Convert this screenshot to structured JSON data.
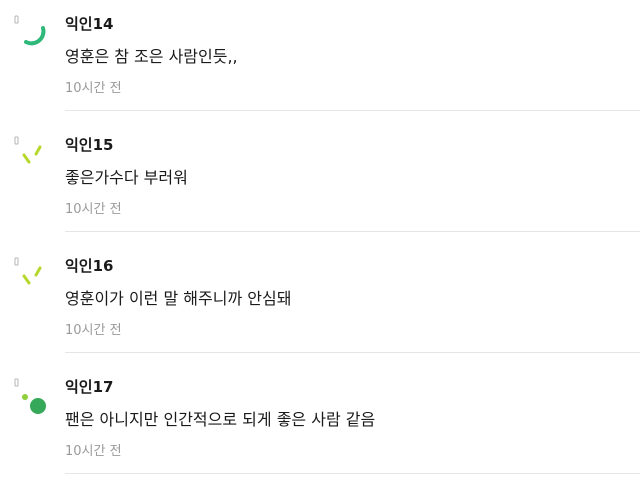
{
  "colors": {
    "green": "#2eb87a",
    "lime": "#b6d82c",
    "dark_green": "#36a85a",
    "badge_gray": "#b5b5b5"
  },
  "comments": [
    {
      "author": "익인14",
      "text": "영훈은 참 조은 사람인듯,,",
      "time": "10시간 전",
      "avatar_icon": "green-arc-icon"
    },
    {
      "author": "익인15",
      "text": "좋은가수다 부러워",
      "time": "10시간 전",
      "avatar_icon": "lime-dashes-icon"
    },
    {
      "author": "익인16",
      "text": "영훈이가 이런 말 해주니까 안심돼",
      "time": "10시간 전",
      "avatar_icon": "lime-dashes-icon"
    },
    {
      "author": "익인17",
      "text": "팬은 아니지만 인간적으로 되게 좋은 사람 같음",
      "time": "10시간 전",
      "avatar_icon": "green-dots-icon"
    }
  ]
}
